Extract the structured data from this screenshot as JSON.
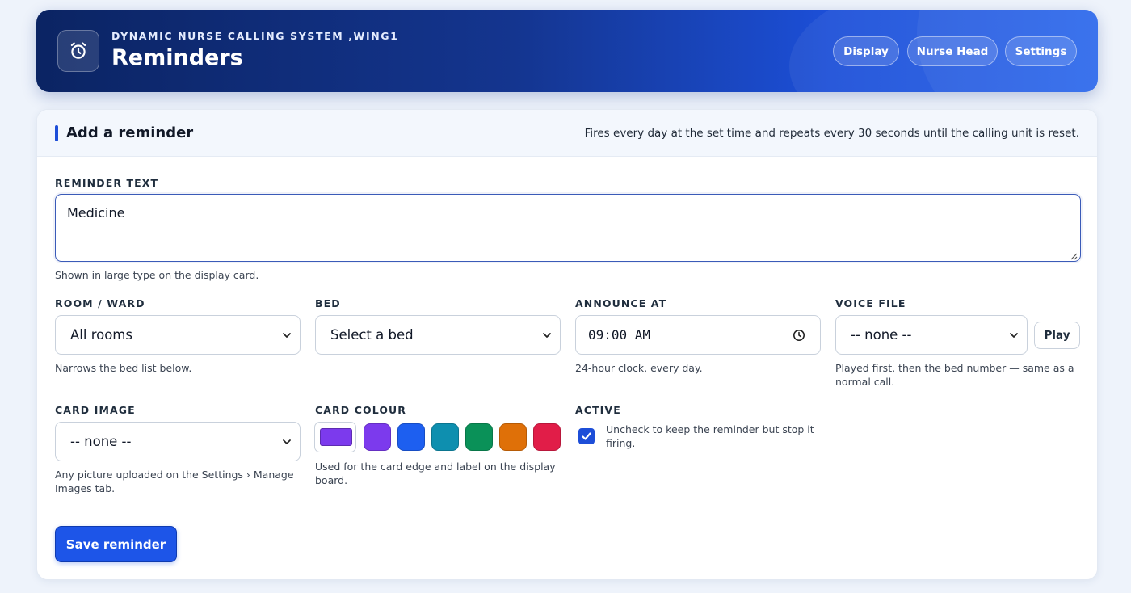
{
  "header": {
    "subtitle": "DYNAMIC NURSE CALLING SYSTEM ,WING1",
    "title": "Reminders",
    "logo_icon": "alarm-clock-icon",
    "nav": [
      "Display",
      "Nurse Head",
      "Settings"
    ]
  },
  "card": {
    "title": "Add a reminder",
    "note": "Fires every day at the set time and repeats every 30 seconds until the calling unit is reset."
  },
  "form": {
    "reminder_text": {
      "label": "REMINDER TEXT",
      "value": "Medicine",
      "help": "Shown in large type on the display card."
    },
    "room": {
      "label": "ROOM / WARD",
      "selected": "All rooms",
      "help": "Narrows the bed list below."
    },
    "bed": {
      "label": "BED",
      "selected": "Select a bed"
    },
    "announce": {
      "label": "ANNOUNCE AT",
      "value": "09:00 AM",
      "help": "24-hour clock, every day."
    },
    "voice": {
      "label": "VOICE FILE",
      "selected": "-- none --",
      "play_label": "Play",
      "help": "Played first, then the bed number — same as a normal call."
    },
    "card_image": {
      "label": "CARD IMAGE",
      "selected": "-- none --",
      "help": "Any picture uploaded on the Settings › Manage Images tab."
    },
    "card_colour": {
      "label": "CARD COLOUR",
      "colors": [
        "#7c3aed",
        "#7c3aed",
        "#1d5ff0",
        "#0e8faf",
        "#0a9158",
        "#df7008",
        "#e11d48"
      ],
      "selected_index": 0,
      "help": "Used for the card edge and label on the display board."
    },
    "active": {
      "label": "ACTIVE",
      "checked": true,
      "help": "Uncheck to keep the reminder but stop it firing."
    },
    "save_label": "Save reminder"
  }
}
